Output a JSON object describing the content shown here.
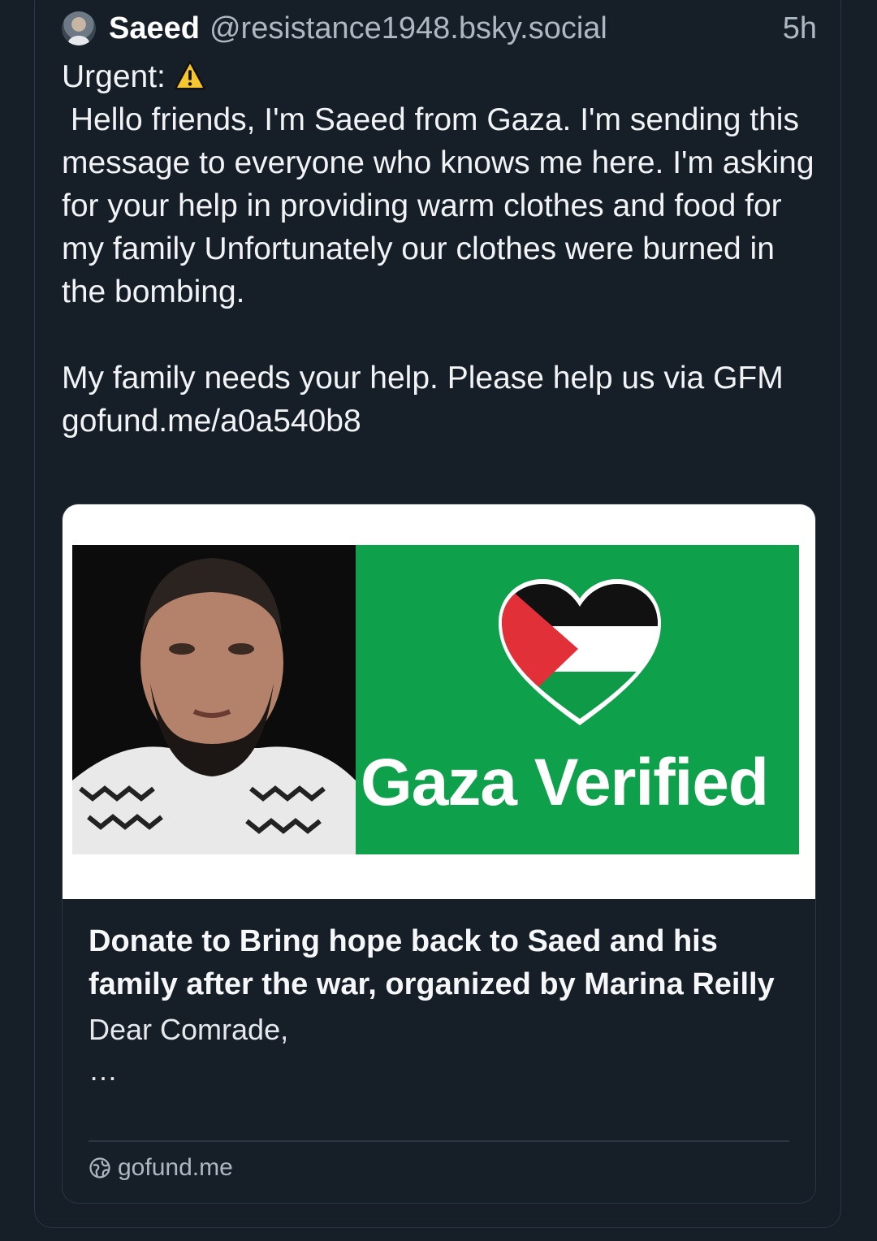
{
  "post": {
    "author_name": "Saeed",
    "author_handle": "@resistance1948.bsky.social",
    "timestamp": "5h",
    "urgent_label": "Urgent:",
    "body": " Hello friends, I'm Saeed from Gaza. I'm sending this message to everyone who knows me here. I'm asking for your help in providing warm clothes and food for my family Unfortunately our clothes were burned in the bombing.\n\nMy family needs your help. Please help us via GFM",
    "link_text": "gofund.me/a0a540b8"
  },
  "link_card": {
    "image_overlay_text": "Gaza Verified",
    "title": "Donate to Bring hope back to Saed and his family after the war, organized by Marina Reilly",
    "description": "Dear Comrade,\n…",
    "domain": "gofund.me"
  },
  "colors": {
    "background": "#161e27",
    "border": "#2a3644",
    "text_primary": "#f1f3f5",
    "text_secondary": "#aeb8c3",
    "card_green": "#0ea04b",
    "flag_red": "#e23038"
  },
  "icons": {
    "warning": "warning-icon",
    "avatar": "avatar",
    "globe": "globe-icon"
  }
}
